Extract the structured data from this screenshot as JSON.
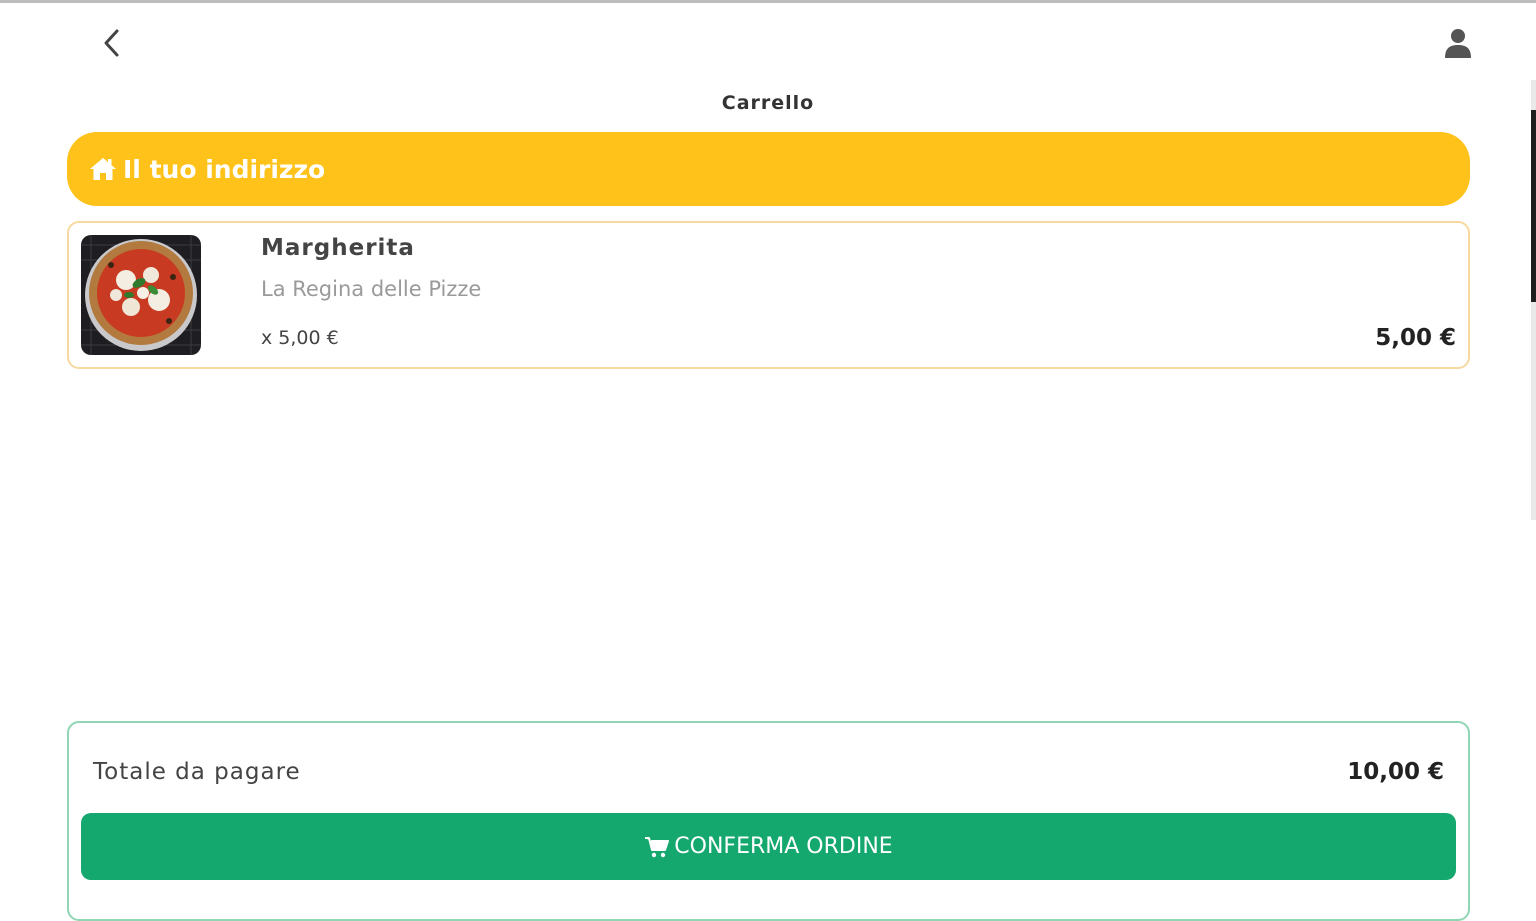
{
  "header": {
    "back_icon": "chevron-left-icon",
    "user_icon": "user-icon",
    "title": "Carrello"
  },
  "address": {
    "icon": "home-icon",
    "label": "Il tuo indirizzo",
    "color": "#ffc21a"
  },
  "cart": {
    "items": [
      {
        "name": "Margherita",
        "restaurant": "La Regina delle Pizze",
        "unit_price": "x 5,00 €",
        "total": "5,00 €",
        "image": "pizza-margherita-image"
      }
    ]
  },
  "summary": {
    "label": "Totale da pagare",
    "amount": "10,00 €",
    "confirm_label": "CONFERMA ORDINE",
    "confirm_icon": "cart-icon",
    "color": "#14a86e"
  }
}
